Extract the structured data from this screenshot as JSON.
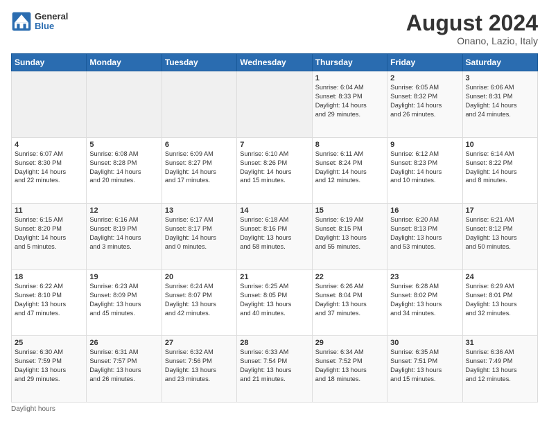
{
  "header": {
    "logo_general": "General",
    "logo_blue": "Blue",
    "main_title": "August 2024",
    "sub_title": "Onano, Lazio, Italy"
  },
  "calendar": {
    "days_of_week": [
      "Sunday",
      "Monday",
      "Tuesday",
      "Wednesday",
      "Thursday",
      "Friday",
      "Saturday"
    ],
    "weeks": [
      [
        {
          "day": "",
          "info": ""
        },
        {
          "day": "",
          "info": ""
        },
        {
          "day": "",
          "info": ""
        },
        {
          "day": "",
          "info": ""
        },
        {
          "day": "1",
          "info": "Sunrise: 6:04 AM\nSunset: 8:33 PM\nDaylight: 14 hours\nand 29 minutes."
        },
        {
          "day": "2",
          "info": "Sunrise: 6:05 AM\nSunset: 8:32 PM\nDaylight: 14 hours\nand 26 minutes."
        },
        {
          "day": "3",
          "info": "Sunrise: 6:06 AM\nSunset: 8:31 PM\nDaylight: 14 hours\nand 24 minutes."
        }
      ],
      [
        {
          "day": "4",
          "info": "Sunrise: 6:07 AM\nSunset: 8:30 PM\nDaylight: 14 hours\nand 22 minutes."
        },
        {
          "day": "5",
          "info": "Sunrise: 6:08 AM\nSunset: 8:28 PM\nDaylight: 14 hours\nand 20 minutes."
        },
        {
          "day": "6",
          "info": "Sunrise: 6:09 AM\nSunset: 8:27 PM\nDaylight: 14 hours\nand 17 minutes."
        },
        {
          "day": "7",
          "info": "Sunrise: 6:10 AM\nSunset: 8:26 PM\nDaylight: 14 hours\nand 15 minutes."
        },
        {
          "day": "8",
          "info": "Sunrise: 6:11 AM\nSunset: 8:24 PM\nDaylight: 14 hours\nand 12 minutes."
        },
        {
          "day": "9",
          "info": "Sunrise: 6:12 AM\nSunset: 8:23 PM\nDaylight: 14 hours\nand 10 minutes."
        },
        {
          "day": "10",
          "info": "Sunrise: 6:14 AM\nSunset: 8:22 PM\nDaylight: 14 hours\nand 8 minutes."
        }
      ],
      [
        {
          "day": "11",
          "info": "Sunrise: 6:15 AM\nSunset: 8:20 PM\nDaylight: 14 hours\nand 5 minutes."
        },
        {
          "day": "12",
          "info": "Sunrise: 6:16 AM\nSunset: 8:19 PM\nDaylight: 14 hours\nand 3 minutes."
        },
        {
          "day": "13",
          "info": "Sunrise: 6:17 AM\nSunset: 8:17 PM\nDaylight: 14 hours\nand 0 minutes."
        },
        {
          "day": "14",
          "info": "Sunrise: 6:18 AM\nSunset: 8:16 PM\nDaylight: 13 hours\nand 58 minutes."
        },
        {
          "day": "15",
          "info": "Sunrise: 6:19 AM\nSunset: 8:15 PM\nDaylight: 13 hours\nand 55 minutes."
        },
        {
          "day": "16",
          "info": "Sunrise: 6:20 AM\nSunset: 8:13 PM\nDaylight: 13 hours\nand 53 minutes."
        },
        {
          "day": "17",
          "info": "Sunrise: 6:21 AM\nSunset: 8:12 PM\nDaylight: 13 hours\nand 50 minutes."
        }
      ],
      [
        {
          "day": "18",
          "info": "Sunrise: 6:22 AM\nSunset: 8:10 PM\nDaylight: 13 hours\nand 47 minutes."
        },
        {
          "day": "19",
          "info": "Sunrise: 6:23 AM\nSunset: 8:09 PM\nDaylight: 13 hours\nand 45 minutes."
        },
        {
          "day": "20",
          "info": "Sunrise: 6:24 AM\nSunset: 8:07 PM\nDaylight: 13 hours\nand 42 minutes."
        },
        {
          "day": "21",
          "info": "Sunrise: 6:25 AM\nSunset: 8:05 PM\nDaylight: 13 hours\nand 40 minutes."
        },
        {
          "day": "22",
          "info": "Sunrise: 6:26 AM\nSunset: 8:04 PM\nDaylight: 13 hours\nand 37 minutes."
        },
        {
          "day": "23",
          "info": "Sunrise: 6:28 AM\nSunset: 8:02 PM\nDaylight: 13 hours\nand 34 minutes."
        },
        {
          "day": "24",
          "info": "Sunrise: 6:29 AM\nSunset: 8:01 PM\nDaylight: 13 hours\nand 32 minutes."
        }
      ],
      [
        {
          "day": "25",
          "info": "Sunrise: 6:30 AM\nSunset: 7:59 PM\nDaylight: 13 hours\nand 29 minutes."
        },
        {
          "day": "26",
          "info": "Sunrise: 6:31 AM\nSunset: 7:57 PM\nDaylight: 13 hours\nand 26 minutes."
        },
        {
          "day": "27",
          "info": "Sunrise: 6:32 AM\nSunset: 7:56 PM\nDaylight: 13 hours\nand 23 minutes."
        },
        {
          "day": "28",
          "info": "Sunrise: 6:33 AM\nSunset: 7:54 PM\nDaylight: 13 hours\nand 21 minutes."
        },
        {
          "day": "29",
          "info": "Sunrise: 6:34 AM\nSunset: 7:52 PM\nDaylight: 13 hours\nand 18 minutes."
        },
        {
          "day": "30",
          "info": "Sunrise: 6:35 AM\nSunset: 7:51 PM\nDaylight: 13 hours\nand 15 minutes."
        },
        {
          "day": "31",
          "info": "Sunrise: 6:36 AM\nSunset: 7:49 PM\nDaylight: 13 hours\nand 12 minutes."
        }
      ]
    ]
  },
  "footer": {
    "note": "Daylight hours"
  }
}
